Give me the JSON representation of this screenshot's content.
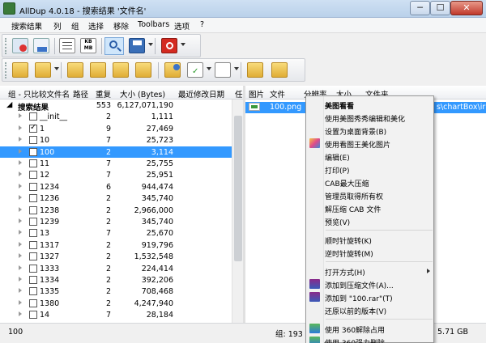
{
  "window": {
    "title": "AllDup 4.0.18 - 搜索结果 '文件名'",
    "min": "─",
    "max": "☐",
    "close": "✕"
  },
  "menu": [
    "搜索结果",
    "列",
    "组",
    "选择",
    "移除",
    "Toolbars",
    "选项",
    "?"
  ],
  "toolbar1": {
    "icons": [
      "delete-files-icon",
      "copy-files-icon",
      "list-view-icon",
      "kb-mb-icon",
      "preview-icon",
      "save-icon",
      "stop-icon"
    ],
    "kb_label": "KB",
    "mb_label": "MB"
  },
  "toolbar2": {
    "icons": [
      "folder-move-left-icon",
      "folder-move-right-icon",
      "folder-up-icon",
      "folder-down-icon",
      "folder-settings-icon",
      "check-file-icon",
      "blank-file-icon",
      "folder-open-icon",
      "folder-search-icon"
    ]
  },
  "tree": {
    "headers": {
      "group": "组 - 只比较文件名",
      "path": "路径",
      "dup": "重复",
      "size": "大小 (Bytes)",
      "date": "最近修改日期",
      "extra": "任"
    },
    "root": {
      "name": "搜索结果",
      "dup": "553",
      "size": "6,127,071,190"
    },
    "rows": [
      {
        "name": "__init__",
        "dup": "2",
        "size": "1,111",
        "checked": false,
        "selected": false
      },
      {
        "name": "1",
        "dup": "9",
        "size": "27,469",
        "checked": true,
        "selected": false
      },
      {
        "name": "10",
        "dup": "7",
        "size": "25,723",
        "checked": false,
        "selected": false
      },
      {
        "name": "100",
        "dup": "2",
        "size": "3,114",
        "checked": false,
        "selected": true
      },
      {
        "name": "11",
        "dup": "7",
        "size": "25,755",
        "checked": false,
        "selected": false
      },
      {
        "name": "12",
        "dup": "7",
        "size": "25,951",
        "checked": false,
        "selected": false
      },
      {
        "name": "1234",
        "dup": "6",
        "size": "944,474",
        "checked": false,
        "selected": false
      },
      {
        "name": "1236",
        "dup": "2",
        "size": "345,740",
        "checked": false,
        "selected": false
      },
      {
        "name": "1238",
        "dup": "2",
        "size": "2,966,000",
        "checked": false,
        "selected": false
      },
      {
        "name": "1239",
        "dup": "2",
        "size": "345,740",
        "checked": false,
        "selected": false
      },
      {
        "name": "13",
        "dup": "7",
        "size": "25,670",
        "checked": false,
        "selected": false
      },
      {
        "name": "1317",
        "dup": "2",
        "size": "919,796",
        "checked": false,
        "selected": false
      },
      {
        "name": "1327",
        "dup": "2",
        "size": "1,532,548",
        "checked": false,
        "selected": false
      },
      {
        "name": "1333",
        "dup": "2",
        "size": "224,414",
        "checked": false,
        "selected": false
      },
      {
        "name": "1334",
        "dup": "2",
        "size": "392,206",
        "checked": false,
        "selected": false
      },
      {
        "name": "1335",
        "dup": "2",
        "size": "708,468",
        "checked": false,
        "selected": false
      },
      {
        "name": "1380",
        "dup": "2",
        "size": "4,247,940",
        "checked": false,
        "selected": false
      },
      {
        "name": "14",
        "dup": "7",
        "size": "28,184",
        "checked": false,
        "selected": false
      }
    ]
  },
  "list": {
    "headers": {
      "image": "图片",
      "file": "文件",
      "resolution": "分辨率",
      "size": "大小",
      "folder": "文件夹"
    },
    "row": {
      "file": "100.png",
      "folder_fragment": "s\\chartBox\\ir"
    }
  },
  "status": {
    "left": "100",
    "group": "组: 193",
    "disk": "5.71 GB"
  },
  "context_menu": {
    "items": [
      {
        "label": "美图看看",
        "bold": true,
        "icon": ""
      },
      {
        "label": "使用美图秀秀编辑和美化",
        "icon": ""
      },
      {
        "label": "设置为桌面背景(B)",
        "icon": ""
      },
      {
        "label": "使用看图王美化图片",
        "icon": "image-editor-icon"
      },
      {
        "label": "编辑(E)",
        "icon": ""
      },
      {
        "label": "打印(P)",
        "icon": ""
      },
      {
        "label": "CAB最大压缩",
        "icon": ""
      },
      {
        "label": "管理员取得所有权",
        "icon": ""
      },
      {
        "label": "解压缩 CAB 文件",
        "icon": ""
      },
      {
        "label": "预览(V)",
        "icon": ""
      },
      {
        "sep": true
      },
      {
        "label": "顺时针旋转(K)",
        "icon": ""
      },
      {
        "label": "逆时针旋转(M)",
        "icon": ""
      },
      {
        "sep": true
      },
      {
        "label": "打开方式(H)",
        "icon": "",
        "submenu": true
      },
      {
        "label": "添加到压缩文件(A)...",
        "icon": "winrar-icon"
      },
      {
        "label": "添加到 \"100.rar\"(T)",
        "icon": "winrar-icon"
      },
      {
        "label": "还原以前的版本(V)",
        "icon": ""
      },
      {
        "sep": true
      },
      {
        "label": "使用 360解除占用",
        "icon": "360-icon"
      },
      {
        "label": "使用 360强力删除",
        "icon": "360-icon"
      }
    ]
  },
  "colors": {
    "selection": "#3399ff",
    "title_bar": "#bad1ea",
    "close_button": "#c0392b",
    "folder": "#e0ad35"
  }
}
